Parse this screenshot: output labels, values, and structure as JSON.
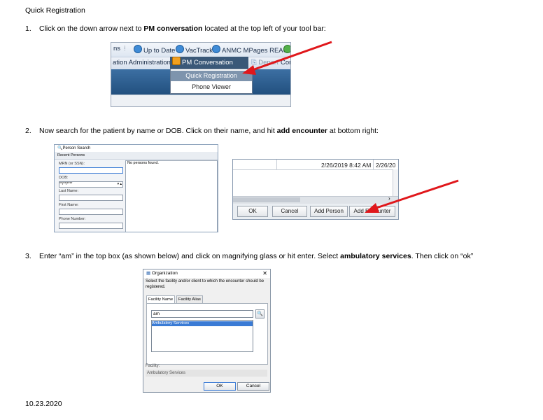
{
  "doc": {
    "title": "Quick Registration",
    "date": "10.23.2020"
  },
  "steps": [
    {
      "num": "1.",
      "t1": "Click on the down arrow next to ",
      "b1": "PM conversation",
      "t2": " located at the top left of your tool bar:"
    },
    {
      "num": "2.",
      "t1": "Now search for the patient by name or DOB.  Click on their name, and hit ",
      "b1": "add encounter",
      "t2": " at bottom right:"
    },
    {
      "num": "3.",
      "t1": "Enter “am” in the top box (as shown below) and click on magnifying glass or hit enter.  Select ",
      "b1": "ambulatory services",
      "t2": ". Then click on “ok”"
    }
  ],
  "shot1": {
    "row1": [
      "ns",
      "Up to Date",
      "VacTrack",
      "ANMC MPages REACH"
    ],
    "row2_left": "ation Administration",
    "pm_button": "PM Conversation",
    "depart": "Depart",
    "comm": "Comm",
    "menu": [
      "Quick Registration",
      "Phone Viewer"
    ],
    "accent": "#e0171b"
  },
  "shot2a": {
    "window_title": "Person Search",
    "recent": "Recent Persons",
    "mrn_label": "MRN (or SSN):",
    "dob_label": "DOB:",
    "dob_value": "**/**/****",
    "last_name_label": "Last Name:",
    "first_name_label": "First Name:",
    "phone_label": "Phone Number:",
    "results": "No persons found."
  },
  "shot2b": {
    "date1": "2/26/2019 8:42 AM",
    "date2": "2/26/20",
    "buttons": [
      "OK",
      "Cancel",
      "Add Person",
      "Add Encounter"
    ]
  },
  "shot3": {
    "title": "Organization",
    "instruction": "Select the facility and/or client to which the encounter should be registered.",
    "tabs": [
      "Facility Name",
      "Facility Alias"
    ],
    "search_value": "am",
    "list_items": [
      "Ambulatory Services"
    ],
    "facility_label": "Facility:",
    "facility_value": "Ambulatory Services",
    "ok": "OK",
    "cancel": "Cancel"
  }
}
